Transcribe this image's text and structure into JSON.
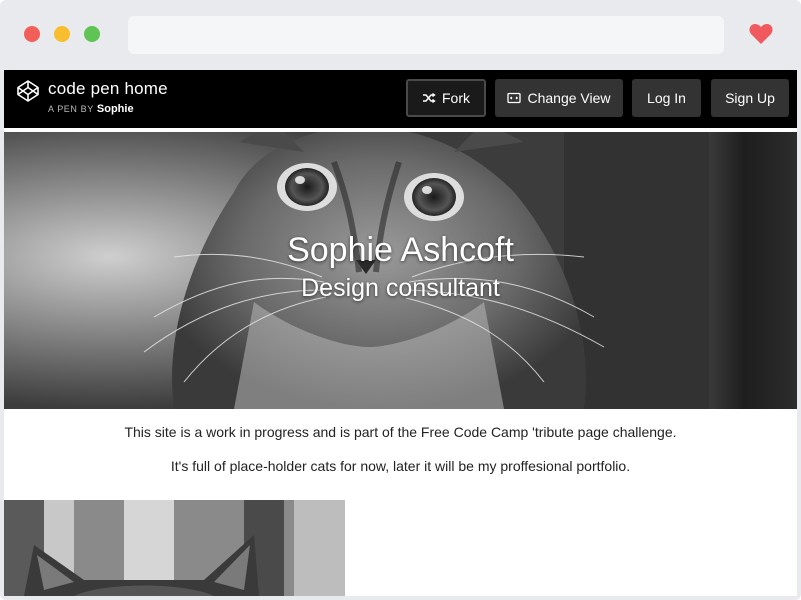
{
  "window": {
    "traffic_lights": [
      "#f25f58",
      "#f9be2f",
      "#5fc454"
    ],
    "heart_color": "#f05a5f"
  },
  "codepen_header": {
    "logo_icon": "codepen-cube-icon",
    "title": "code pen home",
    "byline_prefix": "A PEN BY",
    "byline_author": "Sophie",
    "buttons": {
      "fork": {
        "label": "Fork",
        "icon": "shuffle-icon"
      },
      "change_view": {
        "label": "Change View",
        "icon": "layout-icon"
      },
      "login": {
        "label": "Log In"
      },
      "signup": {
        "label": "Sign Up"
      }
    }
  },
  "hero": {
    "name": "Sophie Ashcoft",
    "role": "Design consultant"
  },
  "content": {
    "paragraph_1": "This site is a work in progress and is part of the Free Code Camp 'tribute page challenge.",
    "paragraph_2": "It's full of place-holder cats for now, later it will be my proffesional portfolio."
  }
}
